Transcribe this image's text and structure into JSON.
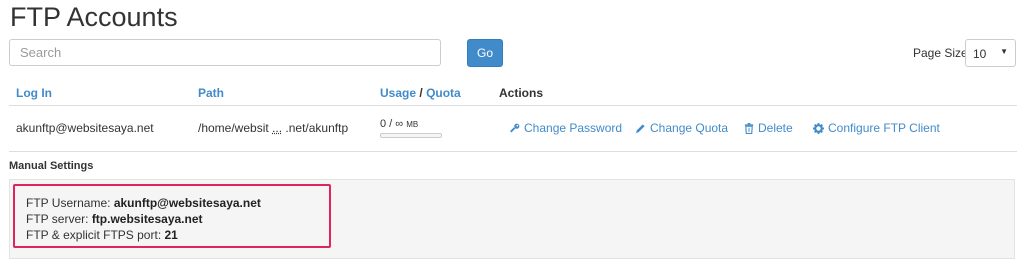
{
  "page": {
    "title": "FTP Accounts"
  },
  "search": {
    "placeholder": "Search",
    "go_label": "Go"
  },
  "page_size": {
    "label": "Page Size",
    "value": "10"
  },
  "table": {
    "headers": {
      "login": "Log In",
      "path": "Path",
      "usage": "Usage",
      "separator": "/",
      "quota": "Quota",
      "actions": "Actions"
    },
    "rows": [
      {
        "login": "akunftp@websitesaya.net",
        "path_start": "/home/websit",
        "path_ellipsis": "...",
        "path_end": ".net/akunftp",
        "usage_value": "0 / ∞",
        "usage_unit": "MB",
        "usage_fraction": 0,
        "actions": {
          "change_password": "Change Password",
          "change_quota": "Change Quota",
          "delete": "Delete",
          "configure": "Configure FTP Client"
        }
      }
    ]
  },
  "manual_settings": {
    "heading": "Manual Settings",
    "username_label": "FTP Username:",
    "username_value": "akunftp@websitesaya.net",
    "server_label": "FTP server:",
    "server_value": "ftp.websitesaya.net",
    "port_label": "FTP & explicit FTPS port:",
    "port_value": "21"
  },
  "colors": {
    "link": "#428bca",
    "highlight": "#e0245e",
    "button": "#428bca"
  },
  "icons": {
    "change_password": "key-icon",
    "change_quota": "pencil-icon",
    "delete": "trash-icon",
    "configure": "gear-icon",
    "page_size_caret": "caret-down-icon"
  }
}
